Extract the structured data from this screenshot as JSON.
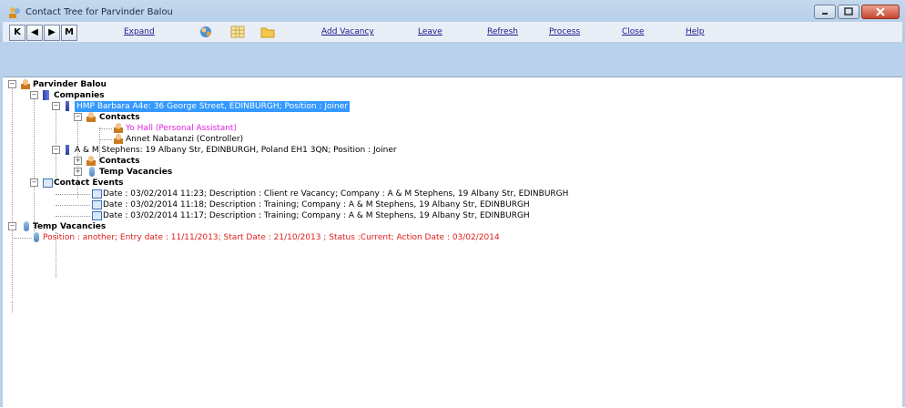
{
  "window": {
    "title": "Contact Tree for Parvinder Balou",
    "icons": {
      "title": "people-icon",
      "minimize": "minimize-icon",
      "maximize": "maximize-icon",
      "close": "close-icon"
    }
  },
  "toolbar": {
    "nav": [
      {
        "label": "K",
        "icon": "first-record-icon"
      },
      {
        "label": "◀",
        "icon": "previous-record-icon"
      },
      {
        "label": "▶",
        "icon": "next-record-icon"
      },
      {
        "label": "M",
        "icon": "last-record-icon"
      }
    ],
    "expand": "Expand",
    "icons": [
      "globe-people-icon",
      "grid-icon",
      "folder-icon"
    ],
    "add_vacancy": "Add Vacancy",
    "leave": "Leave",
    "refresh": "Refresh",
    "process": "Process",
    "close": "Close",
    "help": "Help"
  },
  "tree": {
    "root": "Parvinder Balou",
    "companies": "Companies",
    "company1": "HMP Barbara A4e: 36 George Street, EDINBURGH; Position : Joiner",
    "contacts1": "Contacts",
    "contact1a": "Yo Hall (Personal Assistant)",
    "contact1b": "Annet Nabatanzi (Controller)",
    "company2": "A & M Stephens: 19 Albany Str, EDINBURGH, Poland EH1 3QN; Position : Joiner",
    "contacts2": "Contacts",
    "temp_vac2": "Temp Vacancies",
    "contact_events": "Contact Events",
    "events": [
      "Date : 03/02/2014 11:23; Description : Client re Vacancy; Company : A & M Stephens, 19 Albany Str, EDINBURGH",
      "Date : 03/02/2014 11:18; Description : Training; Company : A & M Stephens, 19 Albany Str, EDINBURGH",
      "Date : 03/02/2014 11:17; Description : Training; Company : A & M Stephens, 19 Albany Str, EDINBURGH"
    ],
    "temp_vacancies": "Temp Vacancies",
    "vacancy": "Position : another; Entry date : 11/11/2013; Start Date : 21/10/2013 ; Status :Current; Action Date : 03/02/2014"
  },
  "colors": {
    "selected": "#3399ff",
    "magenta": "#e020e0",
    "red": "#e01b1b"
  }
}
